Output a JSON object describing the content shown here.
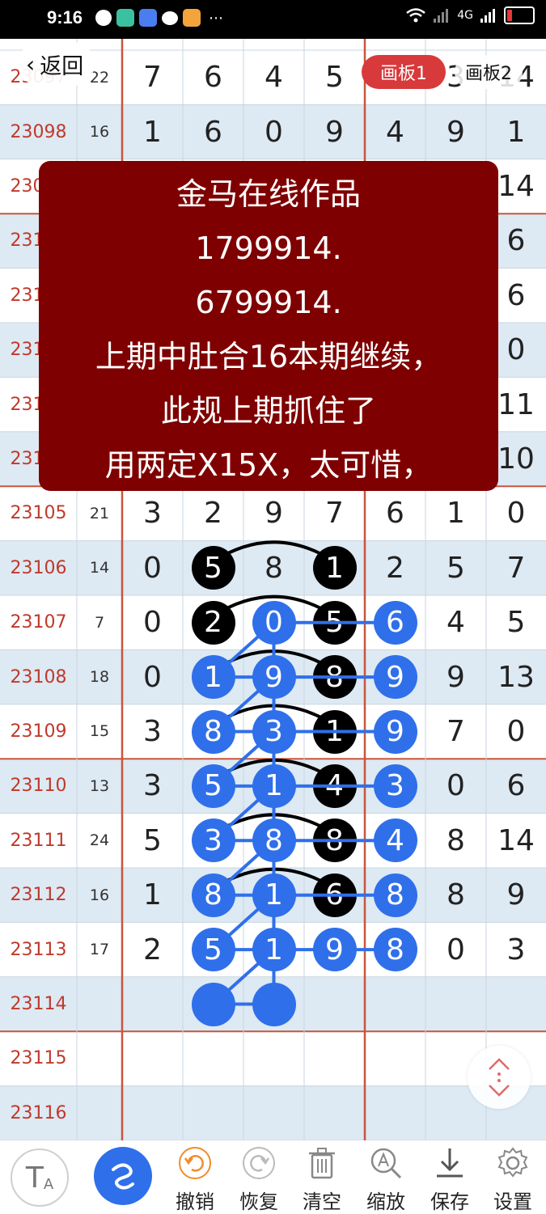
{
  "status_bar": {
    "time": "9:16",
    "network": "4G"
  },
  "nav": {
    "back_label": "返回",
    "tabs": [
      {
        "label": "画板1",
        "active": true
      },
      {
        "label": "画板2",
        "active": false
      }
    ]
  },
  "overlay_text": [
    "金马在线作品",
    "1799914.",
    "6799914.",
    "上期中肚合16本期继续，",
    "此规上期抓住了",
    "用两定X15X，太可惜，"
  ],
  "rows": [
    {
      "period": "23097",
      "sum": "22",
      "digits": [
        "7",
        "6",
        "4",
        "5",
        "",
        "3",
        "14"
      ]
    },
    {
      "period": "23098",
      "sum": "16",
      "digits": [
        "1",
        "6",
        "0",
        "9",
        "4",
        "9",
        "1"
      ]
    },
    {
      "period": "23099",
      "sum": "",
      "digits": [
        "",
        "",
        "",
        "",
        "",
        "",
        "14"
      ]
    },
    {
      "period": "23100",
      "sum": "",
      "digits": [
        "",
        "",
        "",
        "",
        "",
        "",
        "6"
      ]
    },
    {
      "period": "23101",
      "sum": "",
      "digits": [
        "",
        "",
        "",
        "",
        "",
        "",
        "6"
      ]
    },
    {
      "period": "23102",
      "sum": "",
      "digits": [
        "",
        "",
        "",
        "",
        "",
        "",
        "0"
      ]
    },
    {
      "period": "23103",
      "sum": "",
      "digits": [
        "",
        "",
        "",
        "",
        "",
        "",
        "11"
      ]
    },
    {
      "period": "23104",
      "sum": "",
      "digits": [
        "",
        "",
        "",
        "",
        "",
        "",
        "10"
      ]
    },
    {
      "period": "23105",
      "sum": "21",
      "digits": [
        "3",
        "2",
        "9",
        "7",
        "6",
        "1",
        "0"
      ]
    },
    {
      "period": "23106",
      "sum": "14",
      "digits": [
        "0",
        "5",
        "8",
        "1",
        "2",
        "5",
        "7"
      ]
    },
    {
      "period": "23107",
      "sum": "7",
      "digits": [
        "0",
        "2",
        "0",
        "5",
        "6",
        "4",
        "5"
      ]
    },
    {
      "period": "23108",
      "sum": "18",
      "digits": [
        "0",
        "1",
        "9",
        "8",
        "9",
        "9",
        "13"
      ]
    },
    {
      "period": "23109",
      "sum": "15",
      "digits": [
        "3",
        "8",
        "3",
        "1",
        "9",
        "7",
        "0"
      ]
    },
    {
      "period": "23110",
      "sum": "13",
      "digits": [
        "3",
        "5",
        "1",
        "4",
        "3",
        "0",
        "6"
      ]
    },
    {
      "period": "23111",
      "sum": "24",
      "digits": [
        "5",
        "3",
        "8",
        "8",
        "4",
        "8",
        "14"
      ]
    },
    {
      "period": "23112",
      "sum": "16",
      "digits": [
        "1",
        "8",
        "1",
        "6",
        "8",
        "8",
        "9"
      ]
    },
    {
      "period": "23113",
      "sum": "17",
      "digits": [
        "2",
        "5",
        "1",
        "9",
        "8",
        "0",
        "3"
      ]
    },
    {
      "period": "23114",
      "sum": "",
      "digits": [
        "",
        "",
        "",
        "",
        "",
        "",
        ""
      ]
    },
    {
      "period": "23115",
      "sum": "",
      "digits": [
        "",
        "",
        "",
        "",
        "",
        "",
        ""
      ]
    },
    {
      "period": "23116",
      "sum": "",
      "digits": [
        "",
        "",
        "",
        "",
        "",
        "",
        ""
      ]
    }
  ],
  "marks": {
    "black": [
      [
        9,
        1
      ],
      [
        9,
        3
      ],
      [
        10,
        1
      ],
      [
        10,
        3
      ],
      [
        11,
        3
      ],
      [
        12,
        3
      ],
      [
        13,
        3
      ],
      [
        14,
        3
      ],
      [
        15,
        3
      ]
    ],
    "blue": [
      [
        10,
        2
      ],
      [
        10,
        4
      ],
      [
        11,
        1
      ],
      [
        11,
        2
      ],
      [
        11,
        4
      ],
      [
        12,
        1
      ],
      [
        12,
        2
      ],
      [
        12,
        4
      ],
      [
        13,
        1
      ],
      [
        13,
        2
      ],
      [
        13,
        4
      ],
      [
        14,
        1
      ],
      [
        14,
        2
      ],
      [
        14,
        4
      ],
      [
        15,
        1
      ],
      [
        15,
        2
      ],
      [
        15,
        4
      ],
      [
        16,
        1
      ],
      [
        16,
        2
      ],
      [
        16,
        3
      ],
      [
        16,
        4
      ],
      [
        17,
        1
      ],
      [
        17,
        2
      ]
    ],
    "arcs": [
      [
        9,
        1,
        9,
        3
      ],
      [
        10,
        1,
        10,
        3
      ],
      [
        11,
        1,
        11,
        3
      ],
      [
        12,
        1,
        12,
        3
      ],
      [
        13,
        1,
        13,
        3
      ],
      [
        14,
        1,
        14,
        3
      ],
      [
        15,
        1,
        15,
        3
      ]
    ],
    "lines": [
      [
        10,
        2,
        10,
        4
      ],
      [
        11,
        1,
        11,
        4
      ],
      [
        12,
        1,
        12,
        4
      ],
      [
        13,
        1,
        13,
        4
      ],
      [
        14,
        1,
        14,
        4
      ],
      [
        15,
        1,
        15,
        4
      ],
      [
        16,
        1,
        16,
        4
      ],
      [
        17,
        1,
        17,
        2
      ],
      [
        10,
        2,
        17,
        2
      ],
      [
        10,
        2,
        11,
        1
      ],
      [
        11,
        2,
        12,
        1
      ],
      [
        12,
        2,
        13,
        1
      ],
      [
        13,
        2,
        14,
        1
      ],
      [
        14,
        2,
        15,
        1
      ],
      [
        15,
        2,
        16,
        1
      ],
      [
        16,
        2,
        17,
        1
      ]
    ]
  },
  "toolbar": {
    "items": [
      {
        "label": "撤销",
        "icon": "undo-icon"
      },
      {
        "label": "恢复",
        "icon": "redo-icon"
      },
      {
        "label": "清空",
        "icon": "trash-icon"
      },
      {
        "label": "缩放",
        "icon": "zoom-icon"
      },
      {
        "label": "保存",
        "icon": "download-icon"
      },
      {
        "label": "设置",
        "icon": "gear-icon"
      }
    ]
  },
  "colors": {
    "period_text": "#c0392b",
    "grid_red": "#c8553d",
    "row_alt": "#dde9f3",
    "overlay_bg": "#7f0000",
    "ball_blue": "#2f6fea",
    "tab_active": "#d8393b"
  }
}
